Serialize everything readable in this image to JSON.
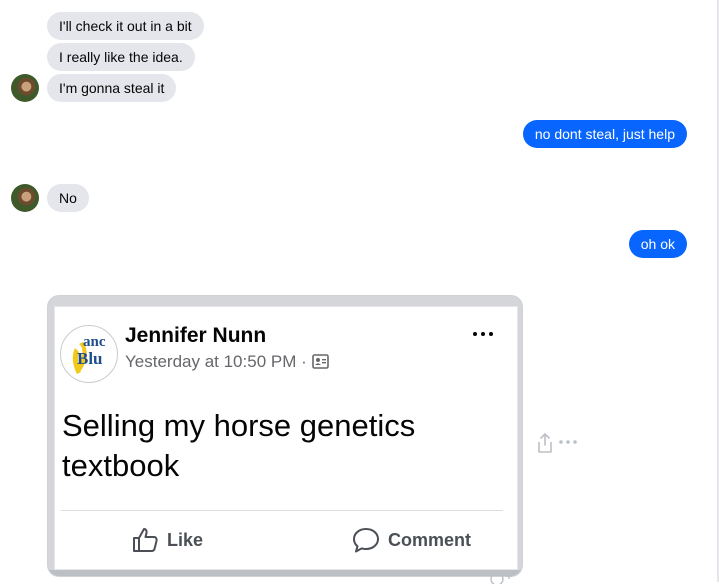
{
  "messages": {
    "incoming_1": "I'll check it out in a bit",
    "incoming_2": "I really like the idea.",
    "incoming_3": "I'm gonna steal it",
    "outgoing_1": "no dont steal, just help",
    "incoming_4": "No",
    "outgoing_2": "oh ok"
  },
  "shared_post": {
    "logo_text_top": "anc",
    "logo_text_bottom": "Blu",
    "author": "Jennifer Nunn",
    "timestamp": "Yesterday at 10:50 PM",
    "separator": "·",
    "audience_icon": "contacts-icon",
    "text": "Selling my horse genetics textbook",
    "like_label": "Like",
    "comment_label": "Comment"
  },
  "colors": {
    "outgoing_bubble": "#0866ff",
    "incoming_bubble": "#e4e6eb",
    "meta_text": "#65676b"
  }
}
